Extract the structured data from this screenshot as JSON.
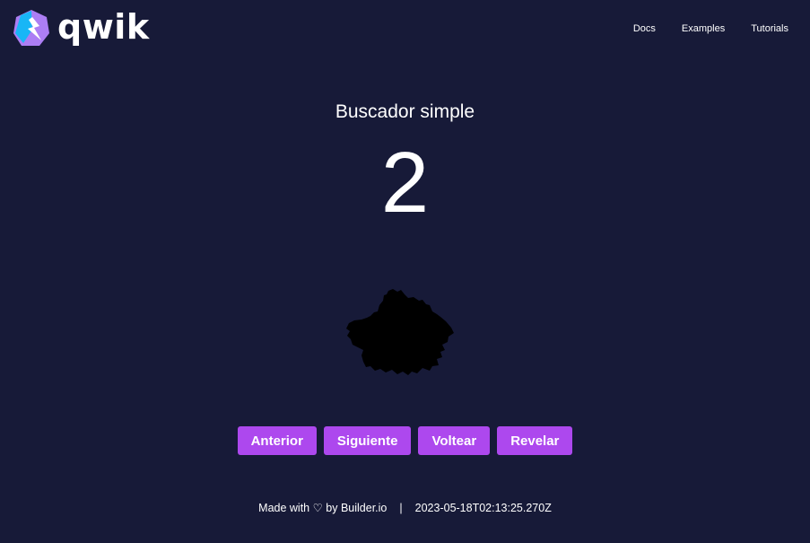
{
  "header": {
    "logo_text": "qwik",
    "nav": [
      {
        "label": "Docs"
      },
      {
        "label": "Examples"
      },
      {
        "label": "Tutorials"
      }
    ]
  },
  "main": {
    "title": "Buscador simple",
    "counter": "2",
    "pokemon_image_icon": "pokemon-silhouette",
    "buttons": {
      "previous": "Anterior",
      "next": "Siguiente",
      "flip": "Voltear",
      "reveal": "Revelar"
    },
    "button_color": "#ad48ee"
  },
  "footer": {
    "made_with": "Made with ♡ by Builder.io",
    "separator": "|",
    "timestamp": "2023-05-18T02:13:25.270Z"
  },
  "colors": {
    "background": "#171a38",
    "logo_blue": "#18b6f6",
    "logo_purple": "#ac7ef4"
  }
}
